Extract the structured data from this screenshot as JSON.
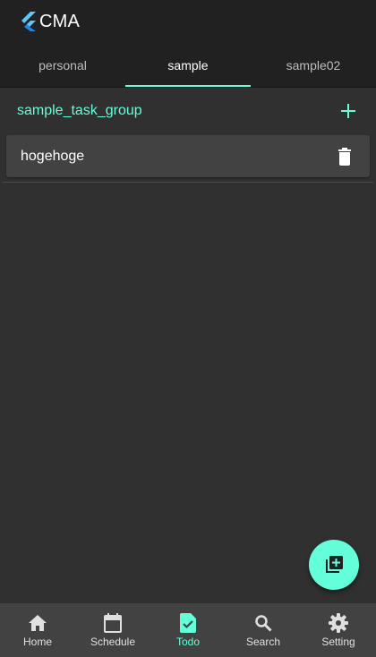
{
  "app": {
    "title": "CMA",
    "logo_icon": "flutter-logo-icon"
  },
  "tabs": [
    {
      "label": "personal",
      "active": false
    },
    {
      "label": "sample",
      "active": true
    },
    {
      "label": "sample02",
      "active": false
    }
  ],
  "group": {
    "title": "sample_task_group",
    "add_icon": "plus-icon"
  },
  "tasks": [
    {
      "title": "hogehoge",
      "delete_icon": "trash-icon"
    }
  ],
  "fab": {
    "icon": "add-to-library-icon"
  },
  "bottom_nav": [
    {
      "label": "Home",
      "icon": "home-icon",
      "active": false
    },
    {
      "label": "Schedule",
      "icon": "calendar-icon",
      "active": false
    },
    {
      "label": "Todo",
      "icon": "task-check-icon",
      "active": true
    },
    {
      "label": "Search",
      "icon": "search-icon",
      "active": false
    },
    {
      "label": "Setting",
      "icon": "gear-icon",
      "active": false
    }
  ],
  "colors": {
    "accent": "#64ffda",
    "appbar": "#212121",
    "background": "#303030",
    "card": "#424242",
    "nav": "#424242"
  }
}
